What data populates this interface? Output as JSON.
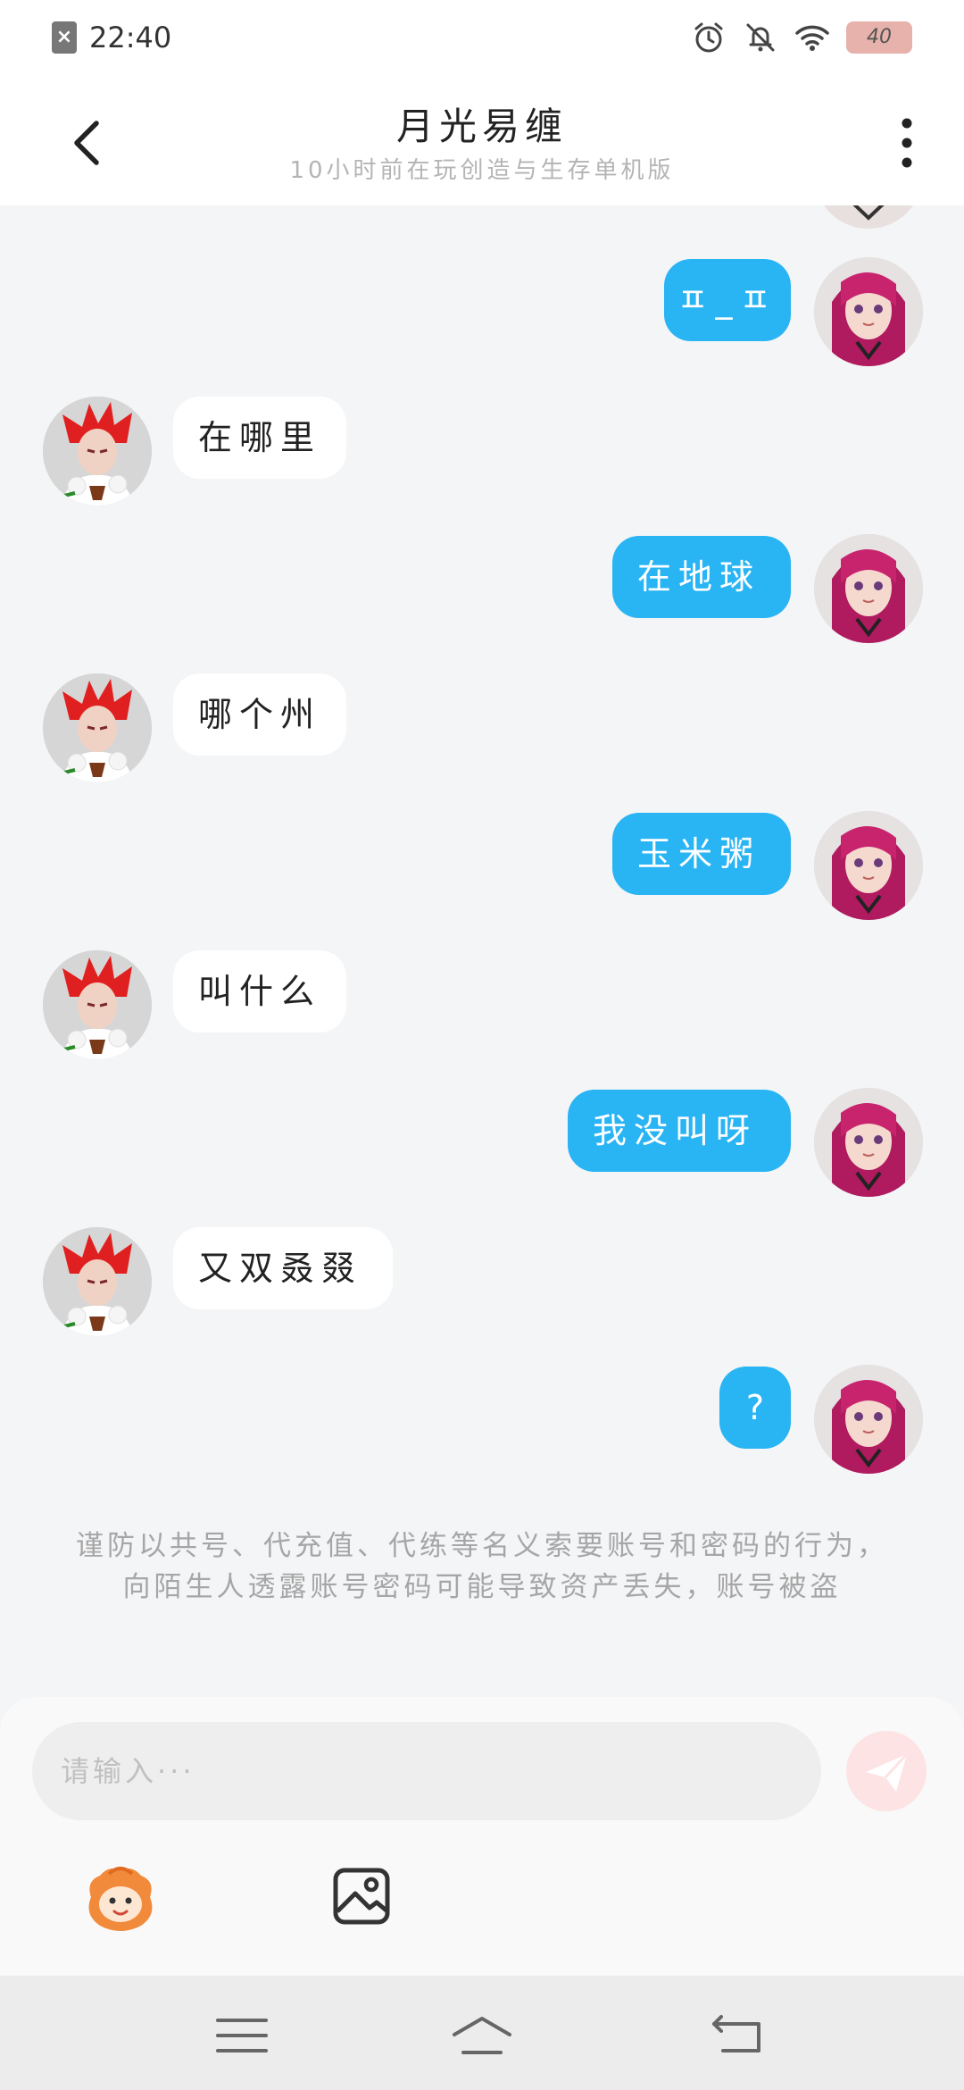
{
  "status_bar": {
    "time": "22:40",
    "sim_icon": "sim-error-icon",
    "icons": [
      "alarm-icon",
      "mute-icon",
      "wifi-icon"
    ],
    "battery_level": "40"
  },
  "header": {
    "title": "月光易缠",
    "subtitle": "10小时前在玩创造与生存单机版",
    "back_icon": "back-arrow-icon",
    "more_icon": "more-vertical-icon"
  },
  "messages": [
    {
      "from": "me",
      "text": "ㅍ_ㅍ"
    },
    {
      "from": "other",
      "text": "在哪里"
    },
    {
      "from": "me",
      "text": "在地球"
    },
    {
      "from": "other",
      "text": "哪个州"
    },
    {
      "from": "me",
      "text": "玉米粥"
    },
    {
      "from": "other",
      "text": "叫什么"
    },
    {
      "from": "me",
      "text": "我没叫呀"
    },
    {
      "from": "other",
      "text": "又双叒叕"
    },
    {
      "from": "me",
      "text": "?"
    }
  ],
  "notice": "谨防以共号、代充值、代练等名义索要账号和密码的行为，向陌生人透露账号密码可能导致资产丢失，账号被盗",
  "input": {
    "placeholder": "请输入···",
    "send_icon": "send-icon",
    "emoji_icon": "sticker-icon",
    "image_icon": "image-icon"
  },
  "nav_bar": {
    "icons": [
      "menu-icon",
      "home-icon",
      "back-icon"
    ]
  },
  "colors": {
    "outgoing_bubble": "#29b4f4",
    "incoming_bubble": "#ffffff",
    "background": "#f4f5f7",
    "send_button": "#fde3e3"
  }
}
